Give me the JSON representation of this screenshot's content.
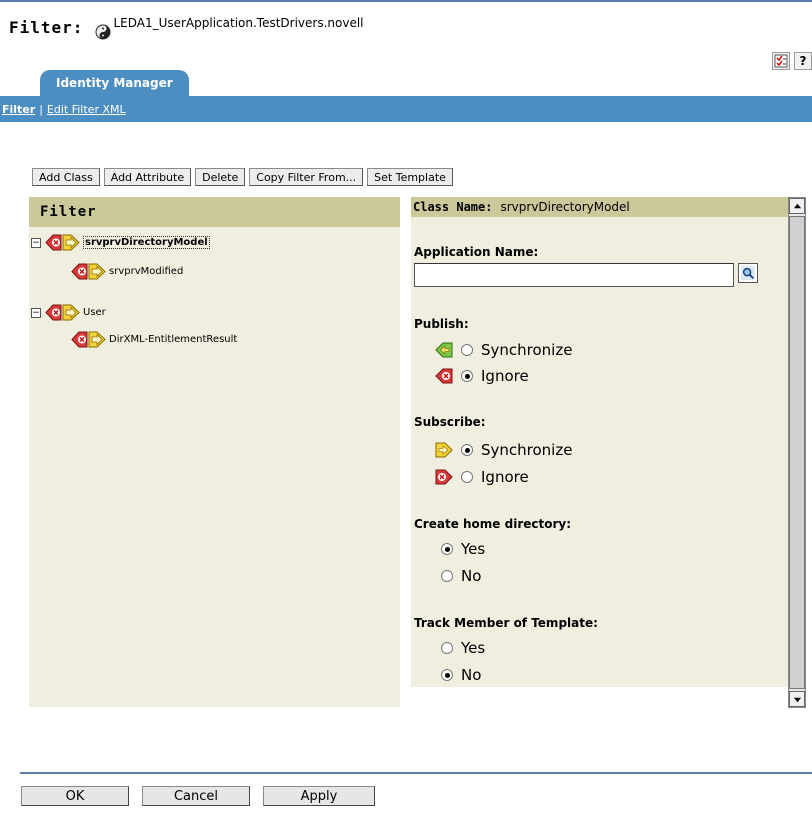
{
  "header": {
    "filter_label": "Filter:",
    "driver_name": "LEDA1_UserApplication.TestDrivers.novell"
  },
  "tab": {
    "label": "Identity Manager",
    "links": [
      "Filter",
      "Edit Filter XML"
    ],
    "separator": "|"
  },
  "toolbar": {
    "buttons": [
      "Add Class",
      "Add Attribute",
      "Delete",
      "Copy Filter From...",
      "Set Template"
    ]
  },
  "left_panel": {
    "title": "Filter",
    "tree": [
      {
        "label": "srvprvDirectoryModel",
        "selected": true,
        "expander": "−"
      },
      {
        "label": "srvprvModified"
      },
      {
        "label": "User",
        "expander": "−"
      },
      {
        "label": "DirXML-EntitlementResult"
      }
    ]
  },
  "right_panel": {
    "class_name_key": "Class Name:",
    "class_name_value": "srvprvDirectoryModel",
    "application_name_label": "Application Name:",
    "application_name_value": "",
    "publish_label": "Publish:",
    "publish_options": [
      "Synchronize",
      "Ignore"
    ],
    "publish_selected": "Ignore",
    "subscribe_label": "Subscribe:",
    "subscribe_options": [
      "Synchronize",
      "Ignore"
    ],
    "subscribe_selected": "Synchronize",
    "home_dir_label": "Create home directory:",
    "home_dir_options": [
      "Yes",
      "No"
    ],
    "home_dir_selected": "Yes",
    "track_label": "Track Member of Template:",
    "track_options": [
      "Yes",
      "No"
    ],
    "track_selected": "No"
  },
  "header_icons": [
    "checklist-icon",
    "help-icon"
  ],
  "help_glyph": "?",
  "footer": {
    "buttons": [
      "OK",
      "Cancel",
      "Apply"
    ]
  },
  "colors": {
    "tab_blue": "#4c8ec2",
    "panel_bg": "#f0eedf",
    "panel_header": "#cbc89a",
    "rule_blue": "#5a7cb0"
  }
}
